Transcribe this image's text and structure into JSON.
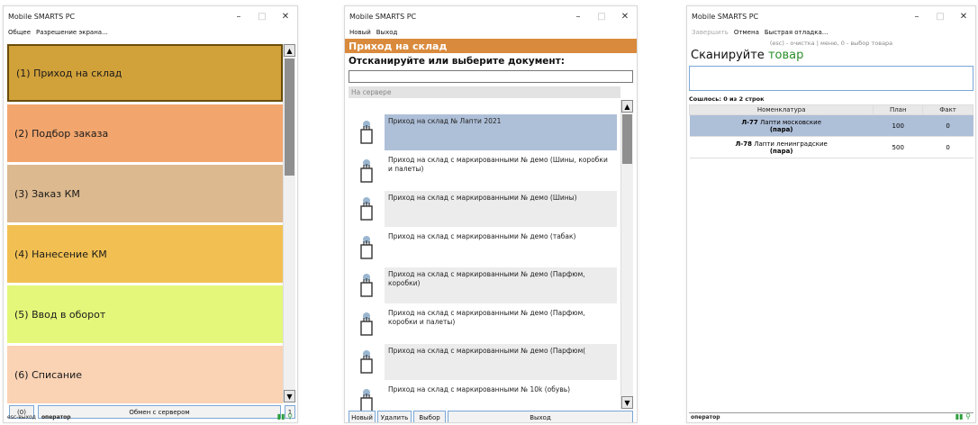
{
  "w1": {
    "title": "Mobile SMARTS PC",
    "menu": [
      "Общее",
      "Разрешение экрана..."
    ],
    "tiles": [
      {
        "label": "(1) Приход на склад",
        "color": "#d1a13a",
        "selected": true
      },
      {
        "label": "(2) Подбор заказа",
        "color": "#f2a66e"
      },
      {
        "label": "(3) Заказ КМ",
        "color": "#dcb98e"
      },
      {
        "label": "(4) Нанесение КМ",
        "color": "#f2c052"
      },
      {
        "label": "(5) Ввод в оборот",
        "color": "#e4f77a"
      },
      {
        "label": "(6) Списание",
        "color": "#fad2b4"
      }
    ],
    "bottom_left": "(0)",
    "bottom_main": "Обмен с сервером",
    "bottom_right": "1",
    "status_left": "esc-выход",
    "status_user": "оператор"
  },
  "w2": {
    "title": "Mobile SMARTS PC",
    "menu": [
      "Новый",
      "Выход"
    ],
    "banner": "Приход на склад",
    "prompt": "Отсканируйте или выберите документ:",
    "group": "На сервере",
    "docs": [
      {
        "text": "Приход на склад № Лапти 2021",
        "selected": true
      },
      {
        "text": "Приход на склад с маркированными № демо (Шины, коробки и палеты)"
      },
      {
        "text": "Приход на склад с маркированными № демо (Шины)"
      },
      {
        "text": "Приход на склад с маркированными № демо (табак)"
      },
      {
        "text": "Приход на склад с маркированными № демо (Парфюм, коробки)"
      },
      {
        "text": "Приход на склад с маркированными № демо (Парфюм, коробки и палеты)"
      },
      {
        "text": "Приход на склад с маркированными № демо (Парфюм("
      },
      {
        "text": "Приход на склад с маркированными № 10k (обувь)"
      }
    ],
    "buttons": [
      "Новый",
      "Удалить",
      "Выбор",
      "Выход"
    ]
  },
  "w3": {
    "title": "Mobile SMARTS PC",
    "menu": [
      "Завершить",
      "Отмена",
      "Быстрая отладка..."
    ],
    "hint": "(esc) - очистка | меню, 0 - выбор товара",
    "scan_prefix": "Сканируйте ",
    "scan_word": "товар",
    "count": "Сошлось: 0 из 2 строк",
    "headers": [
      "Номенклатура",
      "План",
      "Факт"
    ],
    "rows": [
      {
        "code": "Л-77",
        "name": "Лапти московские",
        "unit": "(пара)",
        "plan": "100",
        "fact": "0",
        "selected": true
      },
      {
        "code": "Л-78",
        "name": "Лапти ленинградские",
        "unit": "(пара)",
        "plan": "500",
        "fact": "0"
      }
    ],
    "status_user": "оператор"
  },
  "colors": {
    "banner": "#d98a3c",
    "selected_row": "#aebfd8",
    "accent_blue": "#7aa7d6"
  }
}
